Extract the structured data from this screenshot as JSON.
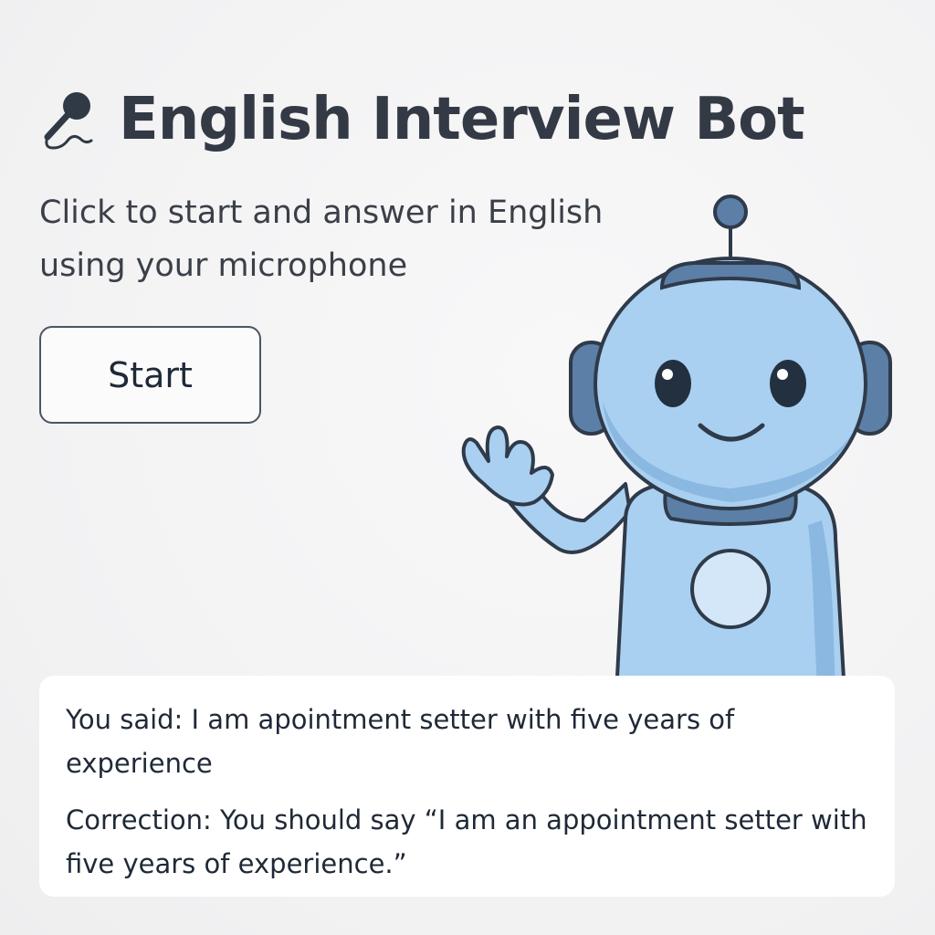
{
  "header": {
    "title": "English Interview Bot",
    "icon": "microphone-icon"
  },
  "subtitle": "Click to start and answer in English using your microphone",
  "start_button": {
    "label": "Start"
  },
  "transcript": {
    "you_said": "You said: I am apointment setter with five years of experience",
    "correction": "Correction: You should say “I am an appointment setter with five years of experience.”"
  },
  "colors": {
    "title": "#333a45",
    "robot_body": "#a9d0f0",
    "robot_dark": "#5b7fa6",
    "outline": "#2f3a4a",
    "card_bg": "#ffffff"
  }
}
